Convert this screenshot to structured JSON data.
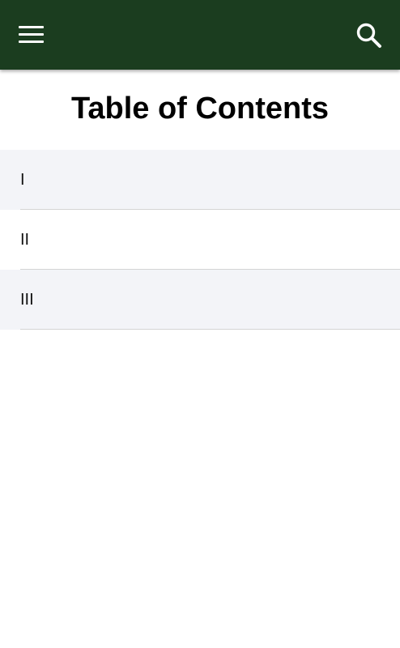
{
  "appbar": {
    "background_color": "#1b3d1f",
    "menu_icon": "hamburger-menu-icon",
    "search_icon": "search-icon"
  },
  "page": {
    "title": "Table of Contents"
  },
  "toc": {
    "items": [
      {
        "label": "I"
      },
      {
        "label": "II"
      },
      {
        "label": "III"
      }
    ],
    "alt_row_color": "#f3f4f8",
    "divider_color": "#d4d4d4"
  }
}
